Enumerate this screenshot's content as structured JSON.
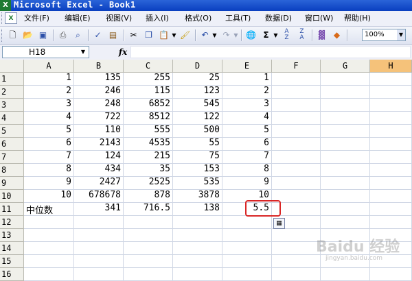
{
  "window": {
    "title": "Microsoft Excel - Book1",
    "app_icon": "excel-icon"
  },
  "menu": [
    "文件(F)",
    "编辑(E)",
    "视图(V)",
    "插入(I)",
    "格式(O)",
    "工具(T)",
    "数据(D)",
    "窗口(W)",
    "帮助(H)"
  ],
  "toolbar": {
    "icons": [
      "new-icon",
      "open-icon",
      "save-icon",
      "print-icon",
      "print-preview-icon",
      "spelling-icon",
      "research-icon",
      "cut-icon",
      "copy-icon",
      "paste-icon",
      "format-painter-icon",
      "undo-icon",
      "redo-icon",
      "hyperlink-icon",
      "autosum-icon",
      "sort-ascending-icon",
      "sort-descending-icon",
      "chart-icon",
      "drawing-icon"
    ],
    "zoom": "100%"
  },
  "formula_bar": {
    "name_box": "H18",
    "fx": "fx",
    "content": ""
  },
  "sheet": {
    "columns": [
      "A",
      "B",
      "C",
      "D",
      "E",
      "F",
      "G",
      "H"
    ],
    "active_column": "H",
    "rows": [
      [
        "1",
        "135",
        "255",
        "25",
        "1"
      ],
      [
        "2",
        "246",
        "115",
        "123",
        "2"
      ],
      [
        "3",
        "248",
        "6852",
        "545",
        "3"
      ],
      [
        "4",
        "722",
        "8512",
        "122",
        "4"
      ],
      [
        "5",
        "110",
        "555",
        "500",
        "5"
      ],
      [
        "6",
        "2143",
        "4535",
        "55",
        "6"
      ],
      [
        "7",
        "124",
        "215",
        "75",
        "7"
      ],
      [
        "8",
        "434",
        "35",
        "153",
        "8"
      ],
      [
        "9",
        "2427",
        "2525",
        "535",
        "9"
      ],
      [
        "10",
        "678678",
        "878",
        "3878",
        "10"
      ],
      [
        "中位数",
        "341",
        "716.5",
        "138",
        "5.5"
      ],
      [
        "",
        "",
        "",
        "",
        ""
      ],
      [
        "",
        "",
        "",
        "",
        ""
      ],
      [
        "",
        "",
        "",
        "",
        ""
      ],
      [
        "",
        "",
        "",
        "",
        ""
      ]
    ],
    "row_numbers": [
      "1",
      "2",
      "3",
      "4",
      "5",
      "6",
      "7",
      "8",
      "9",
      "10",
      "11",
      "12",
      "13",
      "14",
      "15",
      "16"
    ]
  },
  "watermark": {
    "text": "Baidu 经验",
    "sub": "jingyan.baidu.com"
  },
  "colors": {
    "highlight": "#d92626",
    "active_header": "#f5c27a",
    "title_bar": "#0a3fc0"
  }
}
